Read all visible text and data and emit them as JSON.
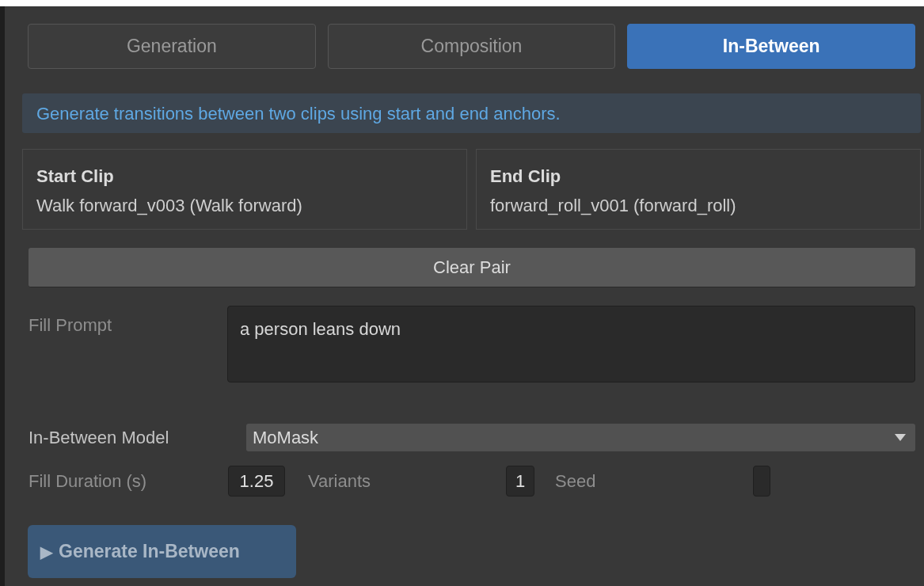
{
  "tabs": [
    {
      "label": "Generation",
      "selected": false
    },
    {
      "label": "Composition",
      "selected": false
    },
    {
      "label": "In-Between",
      "selected": true
    }
  ],
  "info": "Generate transitions between two clips using start and end anchors.",
  "clips": [
    {
      "title": "Start Clip",
      "value": "Walk forward_v003 (Walk forward)"
    },
    {
      "title": "End Clip",
      "value": "forward_roll_v001 (forward_roll)"
    }
  ],
  "clear_button": "Clear Pair",
  "fill_prompt": {
    "label": "Fill Prompt",
    "value": "a person leans down"
  },
  "model": {
    "label": "In-Between Model",
    "value": "MoMask"
  },
  "params": [
    {
      "label": "Fill Duration (s)",
      "value": "1.25"
    },
    {
      "label": "Variants",
      "value": "1"
    },
    {
      "label": "Seed"
    }
  ],
  "generate_button": {
    "icon": "▶",
    "label": "Generate In-Between",
    "disabled": true
  }
}
